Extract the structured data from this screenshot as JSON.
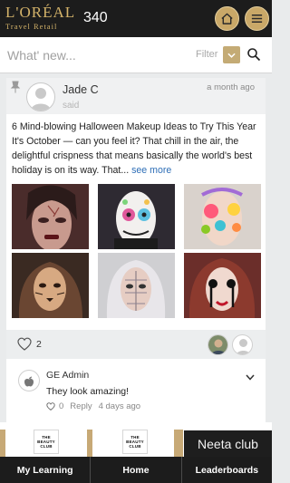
{
  "header": {
    "brand": "L'ORÉAL",
    "brand_sub": "Travel Retail",
    "points": "340"
  },
  "search": {
    "placeholder": "What' new...",
    "filter_label": "Filter"
  },
  "post": {
    "author": "Jade C",
    "said": "said",
    "time": "a month ago",
    "text": "6 Mind-blowing Halloween Makeup Ideas to Try This Year It's October — can you feel it? That chill in the air, the delightful crispness that means basically the world's best holiday is on its way. That...",
    "see_more": "see more",
    "like_count": "2"
  },
  "comment": {
    "author": "GE Admin",
    "text": "They look amazing!",
    "like_count": "0",
    "reply_label": "Reply",
    "time": "4 days ago"
  },
  "ad": {
    "box_lines": [
      "THE",
      "BEAUTY",
      "CLUB"
    ],
    "club_label": "Neeta club"
  },
  "nav": {
    "items": [
      "My Learning",
      "Home",
      "Leaderboards"
    ]
  },
  "colors": {
    "header_bg": "#1c1c1c",
    "gold": "#c9a868",
    "link": "#2f6fb7"
  }
}
